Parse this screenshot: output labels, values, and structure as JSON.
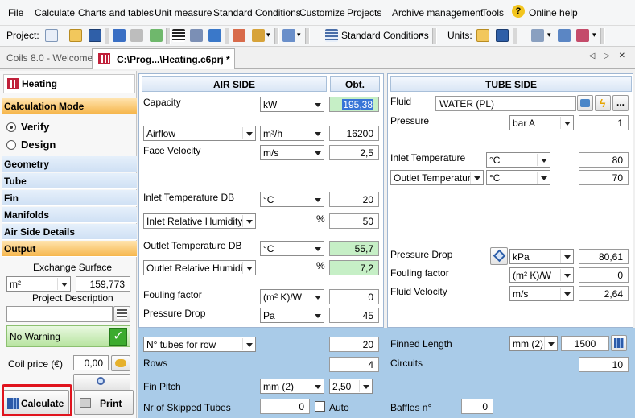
{
  "menu": [
    "File",
    "Calculate",
    "Charts and tables",
    "Unit measure",
    "Standard Conditions",
    "Customize",
    "Projects",
    "Archive management",
    "Tools",
    "Online help"
  ],
  "toolbar": {
    "project_label": "Project:",
    "conditions": "Standard Conditions",
    "units_label": "Units:"
  },
  "tabs": {
    "welcome": "Coils 8.0 - Welcome!",
    "file": "C:\\Prog...\\Heating.c6prj *",
    "nav": "◁ ▷ ✕"
  },
  "sidebar": {
    "title": "Heating",
    "calc_mode": "Calculation Mode",
    "verify": "Verify",
    "design": "Design",
    "sections": [
      "Geometry",
      "Tube",
      "Fin",
      "Manifolds",
      "Air Side Details"
    ],
    "output": "Output",
    "exchange_surface_label": "Exchange Surface",
    "exchange_unit": "m²",
    "exchange_value": "159,773",
    "project_desc_label": "Project Description",
    "project_desc_value": "",
    "warning": "No Warning",
    "coil_price_label": "Coil price (€)",
    "coil_price_value": "0,00",
    "calculate": "Calculate",
    "print": "Print"
  },
  "air": {
    "header": "AIR SIDE",
    "obt": "Obt.",
    "capacity_label": "Capacity",
    "capacity_unit": "kW",
    "capacity_value": "195,38",
    "airflow_select": "Airflow",
    "airflow_unit": "m³/h",
    "airflow_value": "16200",
    "face_vel_label": "Face Velocity",
    "face_vel_unit": "m/s",
    "face_vel_value": "2,5",
    "inlet_db_label": "Inlet Temperature DB",
    "inlet_db_unit": "°C",
    "inlet_db_value": "20",
    "inlet_rh_select": "Inlet Relative Humidity",
    "inlet_rh_unit": "%",
    "inlet_rh_value": "50",
    "outlet_db_label": "Outlet Temperature DB",
    "outlet_db_unit": "°C",
    "outlet_db_value": "55,7",
    "outlet_rh_select": "Outlet Relative Humidity",
    "outlet_rh_unit": "%",
    "outlet_rh_value": "7,2",
    "fouling_label": "Fouling factor",
    "fouling_unit": "(m² K)/W",
    "fouling_value": "0",
    "pdrop_label": "Pressure Drop",
    "pdrop_unit": "Pa",
    "pdrop_value": "45"
  },
  "tube": {
    "header": "TUBE SIDE",
    "fluid_label": "Fluid",
    "fluid_value": "WATER (PL)",
    "pressure_label": "Pressure",
    "pressure_unit": "bar A",
    "pressure_value": "1",
    "inlet_label": "Inlet Temperature",
    "inlet_unit": "°C",
    "inlet_value": "80",
    "outlet_select": "Outlet Temperature",
    "outlet_unit": "°C",
    "outlet_value": "70",
    "pdrop_label": "Pressure Drop",
    "pdrop_unit": "kPa",
    "pdrop_value": "80,61",
    "fouling_label": "Fouling factor",
    "fouling_unit": "(m² K)/W",
    "fouling_value": "0",
    "velocity_label": "Fluid Velocity",
    "velocity_unit": "m/s",
    "velocity_value": "2,64"
  },
  "bottom": {
    "tubes_row_select": "N° tubes for row",
    "tubes_row_value": "20",
    "rows_label": "Rows",
    "rows_value": "4",
    "fin_pitch_label": "Fin Pitch",
    "fin_pitch_unit": "mm (2)",
    "fin_pitch_value": "2,50",
    "skipped_label": "Nr of Skipped Tubes",
    "skipped_value": "0",
    "auto_label": "Auto",
    "finned_length_label": "Finned Length",
    "finned_length_unit": "mm (2)",
    "finned_length_value": "1500",
    "circuits_label": "Circuits",
    "circuits_value": "10",
    "baffles_label": "Baffles n°",
    "baffles_value": "0"
  }
}
